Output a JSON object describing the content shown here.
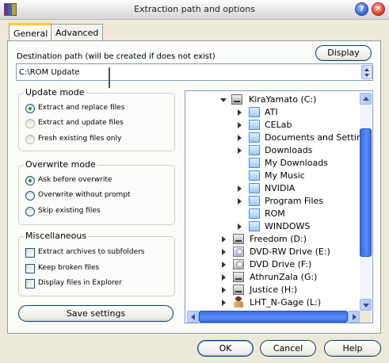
{
  "window": {
    "title": "Extraction path and options"
  },
  "tabs": [
    {
      "label": "General"
    },
    {
      "label": "Advanced"
    }
  ],
  "destination": {
    "label": "Destination path (will be created if does not exist)",
    "value": "C:\\ROM Update",
    "display_button": "Display"
  },
  "update_mode": {
    "title": "Update mode",
    "options": [
      {
        "label": "Extract and replace files",
        "selected": true
      },
      {
        "label": "Extract and update files",
        "selected": false
      },
      {
        "label": "Fresh existing files only",
        "selected": false
      }
    ]
  },
  "overwrite_mode": {
    "title": "Overwrite mode",
    "options": [
      {
        "label": "Ask before overwrite",
        "selected": true
      },
      {
        "label": "Overwrite without prompt",
        "selected": false
      },
      {
        "label": "Skip existing files",
        "selected": false
      }
    ]
  },
  "misc": {
    "title": "Miscellaneous",
    "options": [
      {
        "label": "Extract archives to subfolders",
        "checked": false
      },
      {
        "label": "Keep broken files",
        "checked": false
      },
      {
        "label": "Display files in Explorer",
        "checked": false
      }
    ]
  },
  "save_settings": "Save settings",
  "tree": [
    {
      "label": "KiraYamato (C:)",
      "icon": "hard-drive-icon"
    },
    {
      "label": "ATI",
      "icon": "folder-icon"
    },
    {
      "label": "CELab",
      "icon": "folder-icon"
    },
    {
      "label": "Documents and Settings",
      "icon": "folder-icon"
    },
    {
      "label": "Downloads",
      "icon": "folder-icon"
    },
    {
      "label": "My Downloads",
      "icon": "folder-icon"
    },
    {
      "label": "My Music",
      "icon": "folder-icon"
    },
    {
      "label": "NVIDIA",
      "icon": "folder-icon"
    },
    {
      "label": "Program Files",
      "icon": "folder-icon"
    },
    {
      "label": "ROM",
      "icon": "folder-icon"
    },
    {
      "label": "WINDOWS",
      "icon": "folder-icon"
    },
    {
      "label": "Freedom (D:)",
      "icon": "hard-drive-icon"
    },
    {
      "label": "DVD-RW Drive (E:)",
      "icon": "cd-drive-icon"
    },
    {
      "label": "DVD Drive (F:)",
      "icon": "cd-drive-icon"
    },
    {
      "label": "AthrunZala (G:)",
      "icon": "hard-drive-icon"
    },
    {
      "label": "Justice (H:)",
      "icon": "hard-drive-icon"
    },
    {
      "label": "LHT_N-Gage (L:)",
      "icon": "phone-drive-icon"
    }
  ],
  "buttons": {
    "ok": "OK",
    "cancel": "Cancel",
    "help": "Help"
  }
}
